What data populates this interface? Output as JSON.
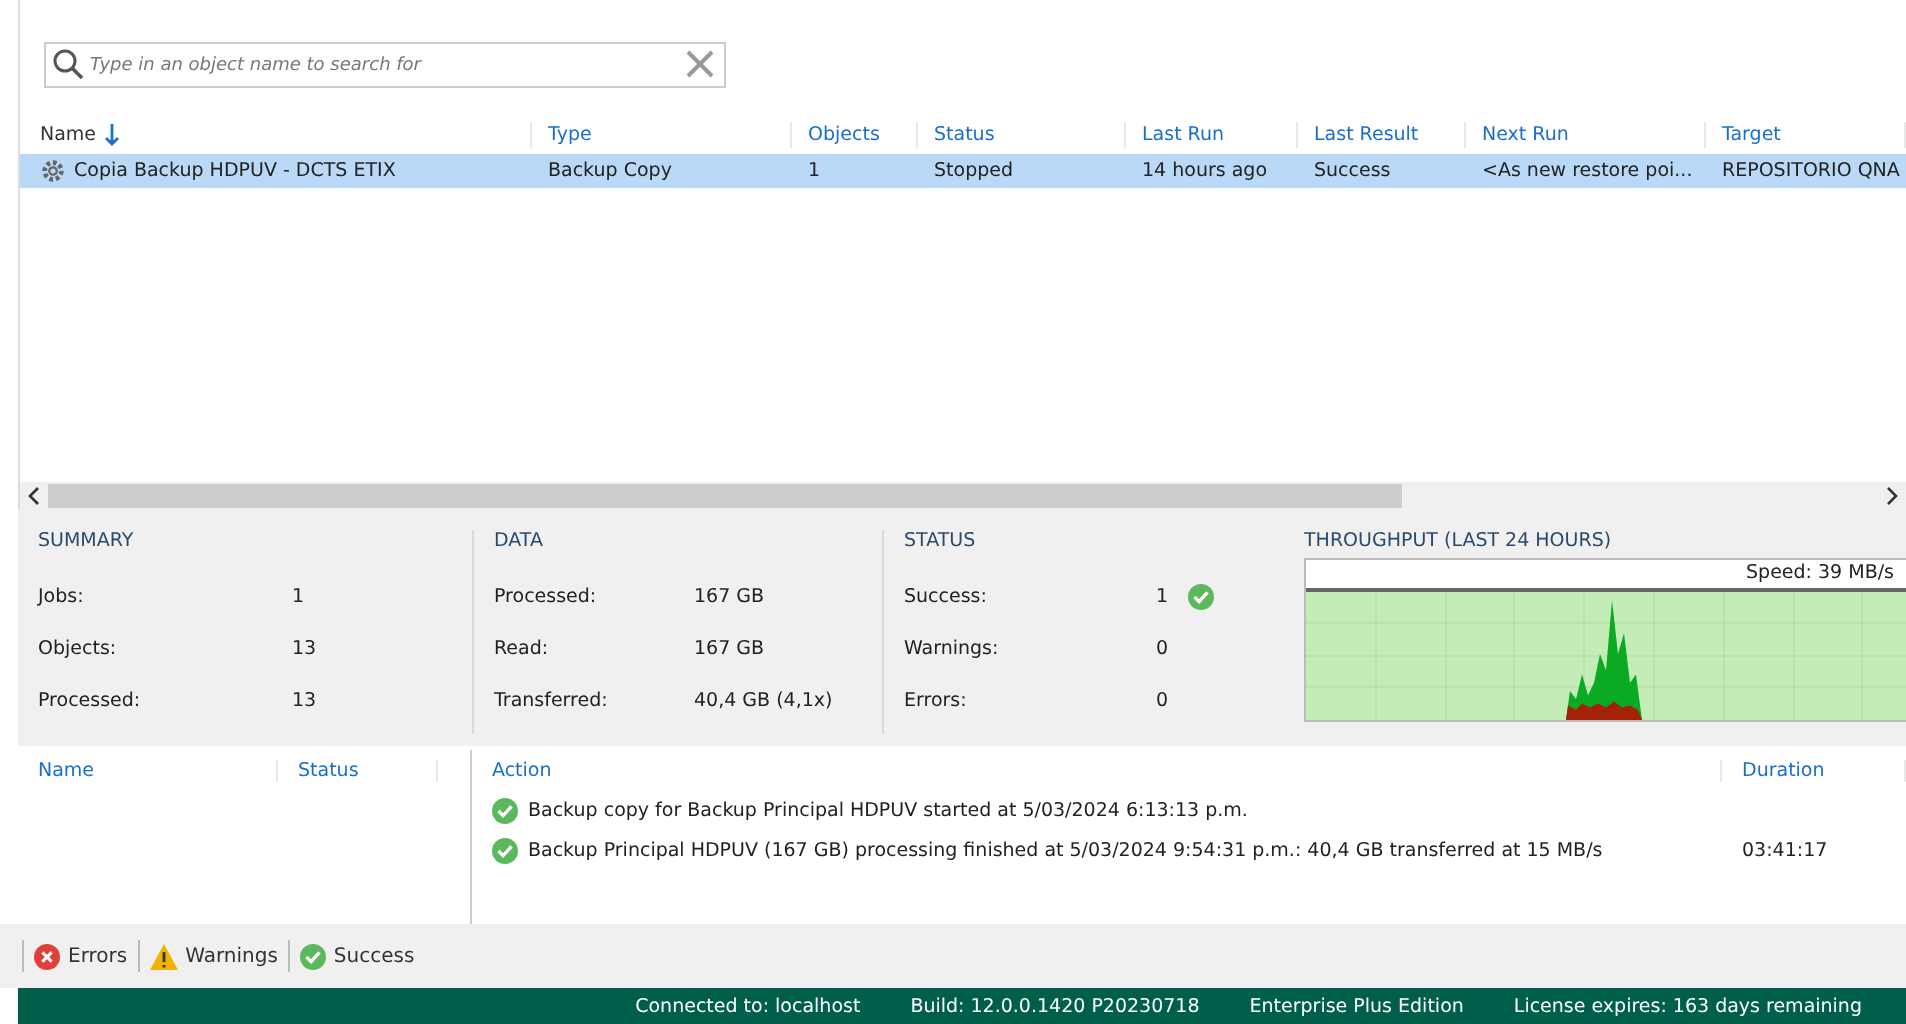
{
  "search": {
    "placeholder": "Type in an object name to search for"
  },
  "table": {
    "columns": [
      {
        "label": "Name",
        "sorted": true
      },
      {
        "label": "Type",
        "sorted": false
      },
      {
        "label": "Objects",
        "sorted": false
      },
      {
        "label": "Status",
        "sorted": false
      },
      {
        "label": "Last Run",
        "sorted": false
      },
      {
        "label": "Last Result",
        "sorted": false
      },
      {
        "label": "Next Run",
        "sorted": false
      },
      {
        "label": "Target",
        "sorted": false
      }
    ],
    "rows": [
      {
        "selected": true,
        "cells": [
          "Copia Backup HDPUV - DCTS ETIX",
          "Backup Copy",
          "1",
          "Stopped",
          "14 hours ago",
          "Success",
          "<As  new restore poi...",
          "REPOSITORIO QNA"
        ]
      }
    ]
  },
  "summary": {
    "title": "SUMMARY",
    "items": [
      {
        "label": "Jobs:",
        "value": "1"
      },
      {
        "label": "Objects:",
        "value": "13"
      },
      {
        "label": "Processed:",
        "value": "13"
      }
    ]
  },
  "data": {
    "title": "DATA",
    "items": [
      {
        "label": "Processed:",
        "value": "167 GB"
      },
      {
        "label": "Read:",
        "value": "167 GB"
      },
      {
        "label": "Transferred:",
        "value": "40,4 GB (4,1x)"
      }
    ]
  },
  "status": {
    "title": "STATUS",
    "items": [
      {
        "label": "Success:",
        "value": "1",
        "kind": "success"
      },
      {
        "label": "Warnings:",
        "value": "0",
        "kind": "plain"
      },
      {
        "label": "Errors:",
        "value": "0",
        "kind": "plain"
      }
    ]
  },
  "throughput": {
    "title": "THROUGHPUT (LAST 24 HOURS)",
    "speed": "Speed: 39 MB/s"
  },
  "log": {
    "columns": [
      "Name",
      "Status",
      "Action",
      "Duration"
    ],
    "entries": [
      {
        "text": "Backup copy for Backup Principal HDPUV started at 5/03/2024 6:13:13 p.m."
      },
      {
        "text": "Backup Principal HDPUV (167 GB) processing finished at 5/03/2024 9:54:31 p.m.: 40,4 GB transferred at 15 MB/s",
        "duration": "03:41:17"
      }
    ]
  },
  "filters": [
    {
      "label": "Errors",
      "kind": "error"
    },
    {
      "label": "Warnings",
      "kind": "warning"
    },
    {
      "label": "Success",
      "kind": "success"
    }
  ],
  "status_bar": [
    "Connected to: localhost",
    "Build: 12.0.0.1420 P20230718",
    "Enterprise Plus Edition",
    "License expires: 163 days remaining"
  ]
}
